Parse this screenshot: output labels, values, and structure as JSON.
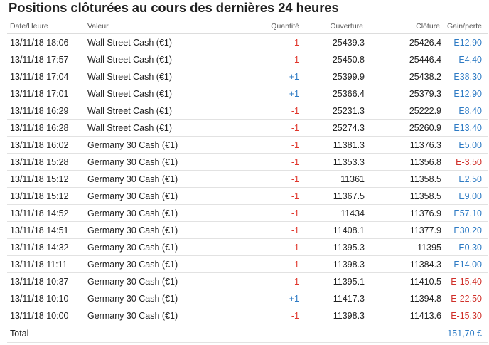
{
  "title": "Positions clôturées au cours des dernières 24 heures",
  "columns": {
    "date": "Date/Heure",
    "valeur": "Valeur",
    "quantite": "Quantité",
    "ouverture": "Ouverture",
    "cloture": "Clôture",
    "gain": "Gain/perte"
  },
  "rows": [
    {
      "date": "13/11/18 18:06",
      "valeur": "Wall Street Cash (€1)",
      "quantite": "-1",
      "ouverture": "25439.3",
      "cloture": "25426.4",
      "gain": "E12.90"
    },
    {
      "date": "13/11/18 17:57",
      "valeur": "Wall Street Cash (€1)",
      "quantite": "-1",
      "ouverture": "25450.8",
      "cloture": "25446.4",
      "gain": "E4.40"
    },
    {
      "date": "13/11/18 17:04",
      "valeur": "Wall Street Cash (€1)",
      "quantite": "+1",
      "ouverture": "25399.9",
      "cloture": "25438.2",
      "gain": "E38.30"
    },
    {
      "date": "13/11/18 17:01",
      "valeur": "Wall Street Cash (€1)",
      "quantite": "+1",
      "ouverture": "25366.4",
      "cloture": "25379.3",
      "gain": "E12.90"
    },
    {
      "date": "13/11/18 16:29",
      "valeur": "Wall Street Cash (€1)",
      "quantite": "-1",
      "ouverture": "25231.3",
      "cloture": "25222.9",
      "gain": "E8.40"
    },
    {
      "date": "13/11/18 16:28",
      "valeur": "Wall Street Cash (€1)",
      "quantite": "-1",
      "ouverture": "25274.3",
      "cloture": "25260.9",
      "gain": "E13.40"
    },
    {
      "date": "13/11/18 16:02",
      "valeur": "Germany 30 Cash (€1)",
      "quantite": "-1",
      "ouverture": "11381.3",
      "cloture": "11376.3",
      "gain": "E5.00"
    },
    {
      "date": "13/11/18 15:28",
      "valeur": "Germany 30 Cash (€1)",
      "quantite": "-1",
      "ouverture": "11353.3",
      "cloture": "11356.8",
      "gain": "E-3.50"
    },
    {
      "date": "13/11/18 15:12",
      "valeur": "Germany 30 Cash (€1)",
      "quantite": "-1",
      "ouverture": "11361",
      "cloture": "11358.5",
      "gain": "E2.50"
    },
    {
      "date": "13/11/18 15:12",
      "valeur": "Germany 30 Cash (€1)",
      "quantite": "-1",
      "ouverture": "11367.5",
      "cloture": "11358.5",
      "gain": "E9.00"
    },
    {
      "date": "13/11/18 14:52",
      "valeur": "Germany 30 Cash (€1)",
      "quantite": "-1",
      "ouverture": "11434",
      "cloture": "11376.9",
      "gain": "E57.10"
    },
    {
      "date": "13/11/18 14:51",
      "valeur": "Germany 30 Cash (€1)",
      "quantite": "-1",
      "ouverture": "11408.1",
      "cloture": "11377.9",
      "gain": "E30.20"
    },
    {
      "date": "13/11/18 14:32",
      "valeur": "Germany 30 Cash (€1)",
      "quantite": "-1",
      "ouverture": "11395.3",
      "cloture": "11395",
      "gain": "E0.30"
    },
    {
      "date": "13/11/18 11:11",
      "valeur": "Germany 30 Cash (€1)",
      "quantite": "-1",
      "ouverture": "11398.3",
      "cloture": "11384.3",
      "gain": "E14.00"
    },
    {
      "date": "13/11/18 10:37",
      "valeur": "Germany 30 Cash (€1)",
      "quantite": "-1",
      "ouverture": "11395.1",
      "cloture": "11410.5",
      "gain": "E-15.40"
    },
    {
      "date": "13/11/18 10:10",
      "valeur": "Germany 30 Cash (€1)",
      "quantite": "+1",
      "ouverture": "11417.3",
      "cloture": "11394.8",
      "gain": "E-22.50"
    },
    {
      "date": "13/11/18 10:00",
      "valeur": "Germany 30 Cash (€1)",
      "quantite": "-1",
      "ouverture": "11398.3",
      "cloture": "11413.6",
      "gain": "E-15.30"
    }
  ],
  "total": {
    "label": "Total",
    "value": "151,70 €"
  },
  "colors": {
    "positive": "#2e7bc4",
    "negative": "#d0302a"
  }
}
